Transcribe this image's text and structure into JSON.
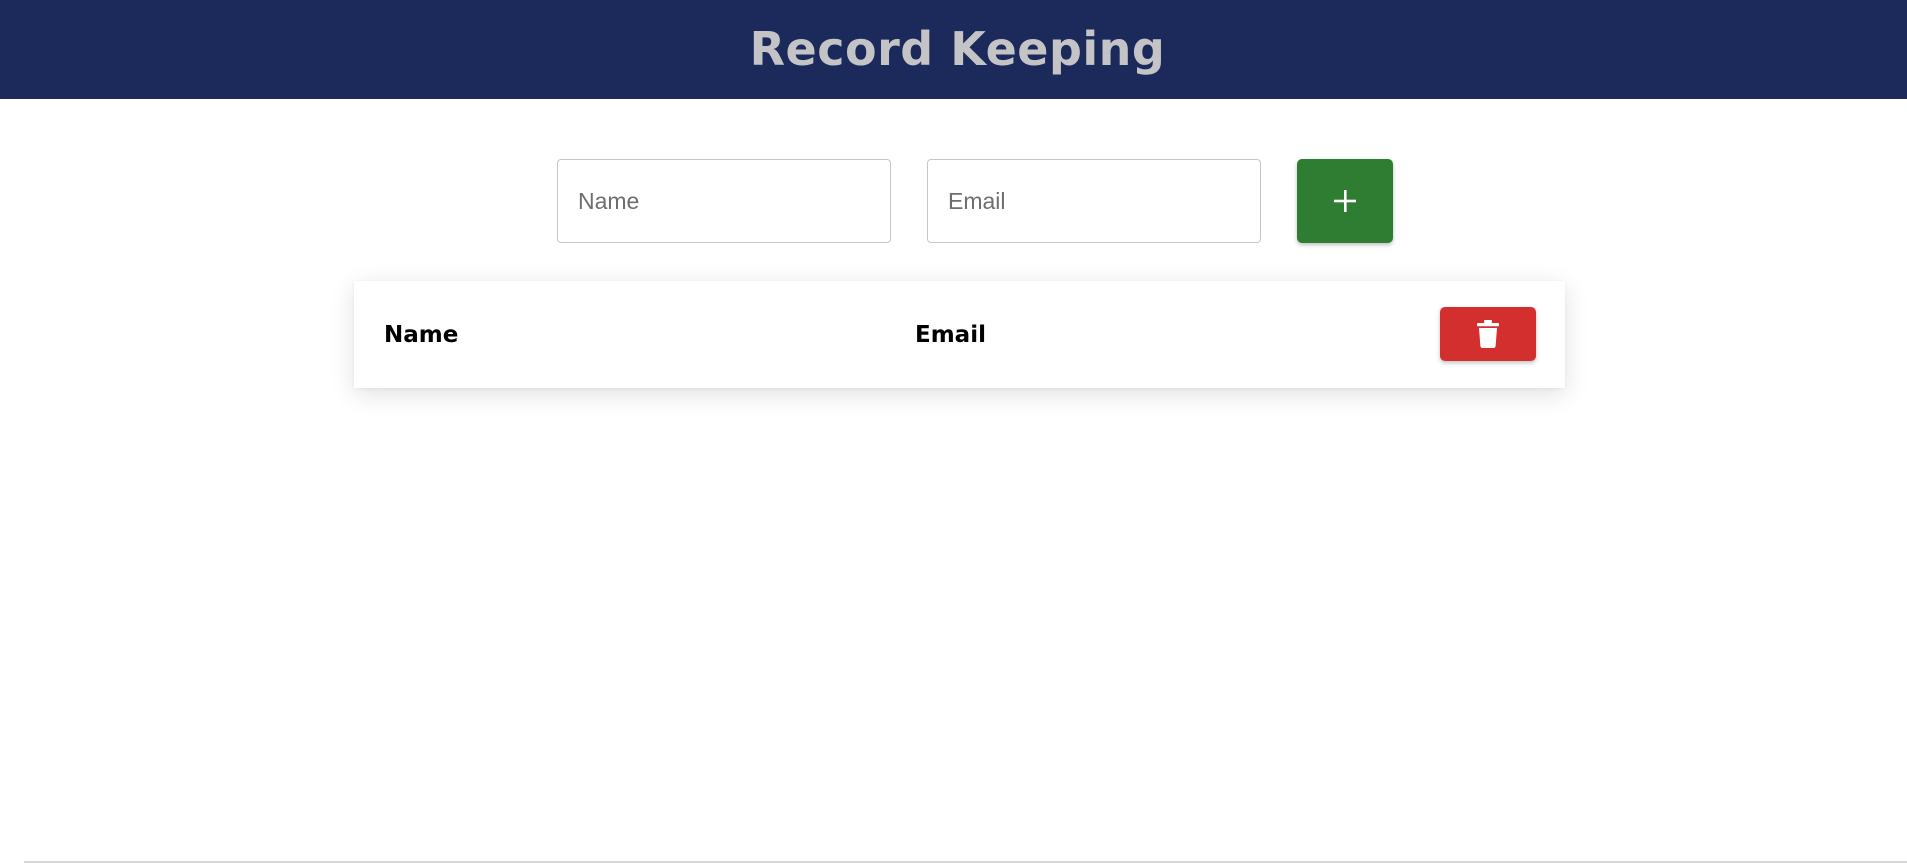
{
  "header": {
    "title": "Record Keeping",
    "background_color": "#1b2a5a",
    "title_color": "#c4c4c6"
  },
  "form": {
    "name_placeholder": "Name",
    "name_value": "",
    "email_placeholder": "Email",
    "email_value": "",
    "add_button_icon": "plus-icon",
    "add_button_color": "#2e7d32"
  },
  "table": {
    "columns": [
      "Name",
      "Email"
    ],
    "rows": [],
    "delete_button_icon": "trash-icon",
    "delete_button_color": "#d32f2f"
  }
}
